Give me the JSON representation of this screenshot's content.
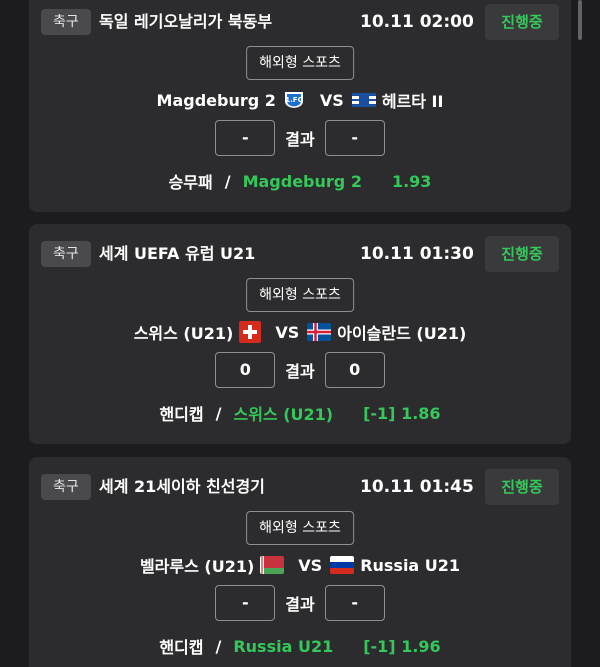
{
  "matches": [
    {
      "sport": "축구",
      "league": "독일 레기오날리가 북동부",
      "time": "10.11 02:00",
      "status": "진행중",
      "provider": "해외형 스포츠",
      "home": "Magdeburg 2",
      "home_flag": "magdeburg-crest-icon",
      "vs": "VS",
      "away": "헤르타 II",
      "away_flag": "hertha-crest-icon",
      "home_score": "-",
      "result_label": "결과",
      "away_score": "-",
      "bet_type": "승무패",
      "bet_sep": "/",
      "bet_pick": "Magdeburg 2",
      "bet_odds": "1.93"
    },
    {
      "sport": "축구",
      "league": "세계 UEFA 유럽 U21",
      "time": "10.11 01:30",
      "status": "진행중",
      "provider": "해외형 스포츠",
      "home": "스위스 (U21)",
      "home_flag": "switzerland-flag-icon",
      "vs": "VS",
      "away": "아이슬란드 (U21)",
      "away_flag": "iceland-flag-icon",
      "home_score": "0",
      "result_label": "결과",
      "away_score": "0",
      "bet_type": "핸디캡",
      "bet_sep": "/",
      "bet_pick": "스위스 (U21)",
      "bet_odds": "[-1] 1.86"
    },
    {
      "sport": "축구",
      "league": "세계 21세이하 친선경기",
      "time": "10.11 01:45",
      "status": "진행중",
      "provider": "해외형 스포츠",
      "home": "벨라루스 (U21)",
      "home_flag": "belarus-flag-icon",
      "vs": "VS",
      "away": "Russia U21",
      "away_flag": "russia-flag-icon",
      "home_score": "-",
      "result_label": "결과",
      "away_score": "-",
      "bet_type": "핸디캡",
      "bet_sep": "/",
      "bet_pick": "Russia U21",
      "bet_odds": "[-1] 1.96"
    }
  ],
  "colors": {
    "background": "#1c1c1e",
    "card": "#2c2c2e",
    "accent_green": "#34c759",
    "badge": "#4a4a4c"
  }
}
